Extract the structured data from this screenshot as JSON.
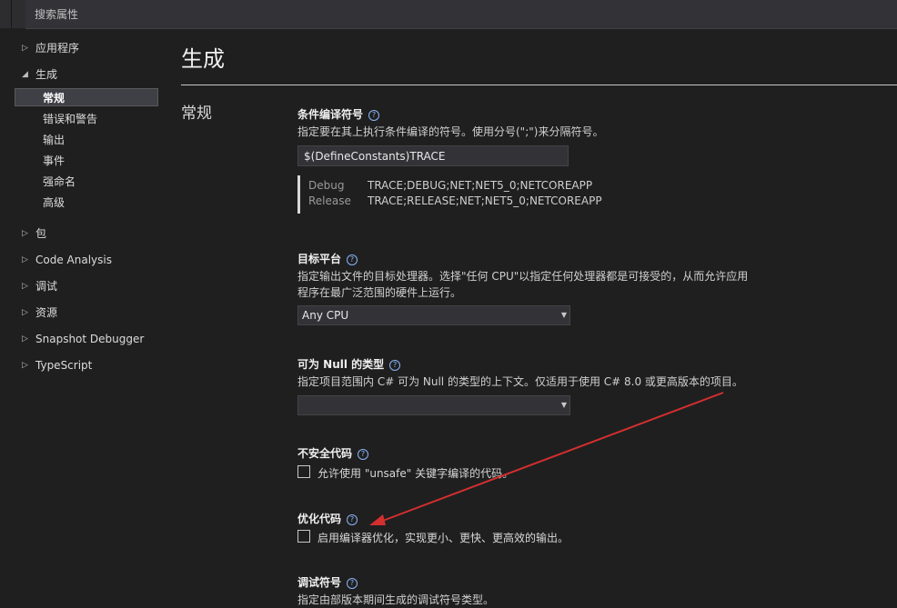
{
  "search": {
    "placeholder": "搜索属性"
  },
  "sidebar": {
    "items": [
      {
        "label": "应用程序",
        "expander": "▷"
      },
      {
        "label": "生成",
        "expander": "◢"
      },
      {
        "label": "包",
        "expander": "▷"
      },
      {
        "label": "Code Analysis",
        "expander": "▷"
      },
      {
        "label": "调试",
        "expander": "▷"
      },
      {
        "label": "资源",
        "expander": "▷"
      },
      {
        "label": "Snapshot Debugger",
        "expander": "▷"
      },
      {
        "label": "TypeScript",
        "expander": "▷"
      }
    ],
    "build_children": [
      "常规",
      "错误和警告",
      "输出",
      "事件",
      "强命名",
      "高级"
    ],
    "selected": "常规"
  },
  "main": {
    "title": "生成",
    "section": "常规",
    "conditional_symbols": {
      "label": "条件编译符号",
      "description": "指定要在其上执行条件编译的符号。使用分号(\";\")来分隔符号。",
      "value": "$(DefineConstants)TRACE",
      "configs": [
        {
          "name": "Debug",
          "value": "TRACE;DEBUG;NET;NET5_0;NETCOREAPP"
        },
        {
          "name": "Release",
          "value": "TRACE;RELEASE;NET;NET5_0;NETCOREAPP"
        }
      ]
    },
    "platform_target": {
      "label": "目标平台",
      "description_line1": "指定输出文件的目标处理器。选择\"任何 CPU\"以指定任何处理器都是可接受的，从而允许应用",
      "description_line2": "程序在最广泛范围的硬件上运行。",
      "value": "Any CPU"
    },
    "nullable": {
      "label": "可为 Null 的类型",
      "description": "指定项目范围内 C# 可为 Null 的类型的上下文。仅适用于使用 C# 8.0 或更高版本的项目。",
      "value": ""
    },
    "unsafe": {
      "label": "不安全代码",
      "checkbox_label": "允许使用 \"unsafe\" 关键字编译的代码。",
      "checked": false
    },
    "optimize": {
      "label": "优化代码",
      "checkbox_label": "启用编译器优化，实现更小、更快、更高效的输出。",
      "checked": false
    },
    "debug_symbols": {
      "label": "调试符号",
      "description": "指定由部版本期间生成的调试符号类型。"
    },
    "help_glyph": "?"
  },
  "colors": {
    "background": "#1f1f1f",
    "annotation_arrow": "#d32f2f",
    "help_icon": "#8ab4f8"
  }
}
